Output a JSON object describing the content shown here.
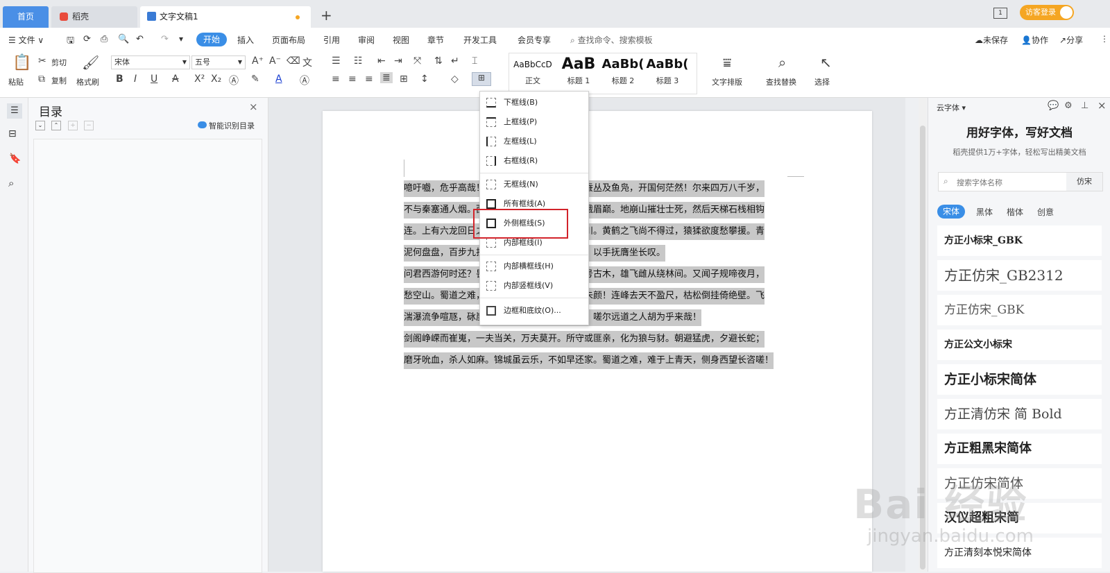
{
  "tabs": {
    "home": "首页",
    "daoke": "稻壳",
    "doc": "文字文稿1",
    "add": "+"
  },
  "topright": {
    "login": "访客登录"
  },
  "menu": {
    "file": "文件",
    "items": [
      "开始",
      "插入",
      "页面布局",
      "引用",
      "审阅",
      "视图",
      "章节",
      "开发工具",
      "会员专享"
    ],
    "search": "查找命令、搜索模板",
    "unsaved": "未保存",
    "collab": "协作",
    "share": "分享"
  },
  "ribbon": {
    "paste": "粘贴",
    "cut": "剪切",
    "copy": "复制",
    "format_painter": "格式刷",
    "font_name": "宋体",
    "font_size": "五号",
    "styles": [
      {
        "sample": "AaBbCcD",
        "name": "正文"
      },
      {
        "sample": "AaB",
        "name": "标题 1"
      },
      {
        "sample": "AaBb(",
        "name": "标题 2"
      },
      {
        "sample": "AaBb(",
        "name": "标题 3"
      }
    ],
    "text_layout": "文字排版",
    "find_replace": "查找替换",
    "select": "选择"
  },
  "toc": {
    "title": "目录",
    "smart": "智能识别目录"
  },
  "document": {
    "lines": [
      "噫吁嚱，危乎高哉！蜀道之难，难于上青天！蚕丛及鱼凫，开国何茫然！尔来四万八千岁，",
      "不与秦塞通人烟。西当太白有鸟道，可以横绝峨眉巅。地崩山摧壮士死，然后天梯石栈相钩",
      "连。上有六龙回日之高标，下有冲波逆折之回川。黄鹤之飞尚不得过，猿猱欲度愁攀援。青",
      "泥何盘盘，百步九折萦岩峦。扪参历井仰胁息，以手抚膺坐长叹。",
      "问君西游何时还？畏途巉岩不可攀。但见悲鸟号古木，雄飞雌从绕林间。又闻子规啼夜月，",
      "愁空山。蜀道之难，难于上青天，使人听此凋朱颜！连峰去天不盈尺，枯松倒挂倚绝壁。飞",
      "湍瀑流争喧豗，砯崖转石万壑雷。其险也如此，嗟尔远道之人胡为乎来哉！",
      "剑阁峥嵘而崔嵬，一夫当关，万夫莫开。所守或匪亲，化为狼与豺。朝避猛虎，夕避长蛇；",
      "磨牙吮血，杀人如麻。锦城虽云乐，不如早还家。蜀道之难，难于上青天，侧身西望长咨嗟！"
    ]
  },
  "border_menu": {
    "items": [
      "下框线(B)",
      "上框线(P)",
      "左框线(L)",
      "右框线(R)",
      "无框线(N)",
      "所有框线(A)",
      "外侧框线(S)",
      "内部框线(I)",
      "内部横框线(H)",
      "内部竖框线(V)",
      "边框和底纹(O)..."
    ]
  },
  "cloud_font": {
    "header": "云字体",
    "title": "用好字体，写好文档",
    "subtitle": "稻壳提供1万+字体，轻松写出精美文档",
    "search_placeholder": "搜索字体名称",
    "search_tag": "仿宋",
    "categories": [
      "宋体",
      "黑体",
      "楷体",
      "创意"
    ],
    "fonts": [
      "方正小标宋_GBK",
      "方正仿宋_GB2312",
      "方正仿宋_GBK",
      "方正公文小标宋",
      "方正小标宋简体",
      "方正清仿宋 简 Bold",
      "方正粗黑宋简体",
      "方正仿宋简体",
      "汉仪超粗宋简",
      "方正清刻本悦宋简体"
    ]
  },
  "watermark": {
    "brand": "Bai 经验",
    "url": "jingyan.baidu.com"
  },
  "colors": {
    "accent": "#3a8ee6",
    "highlight_box": "#d2232a",
    "selection": "#c8c8c8"
  }
}
